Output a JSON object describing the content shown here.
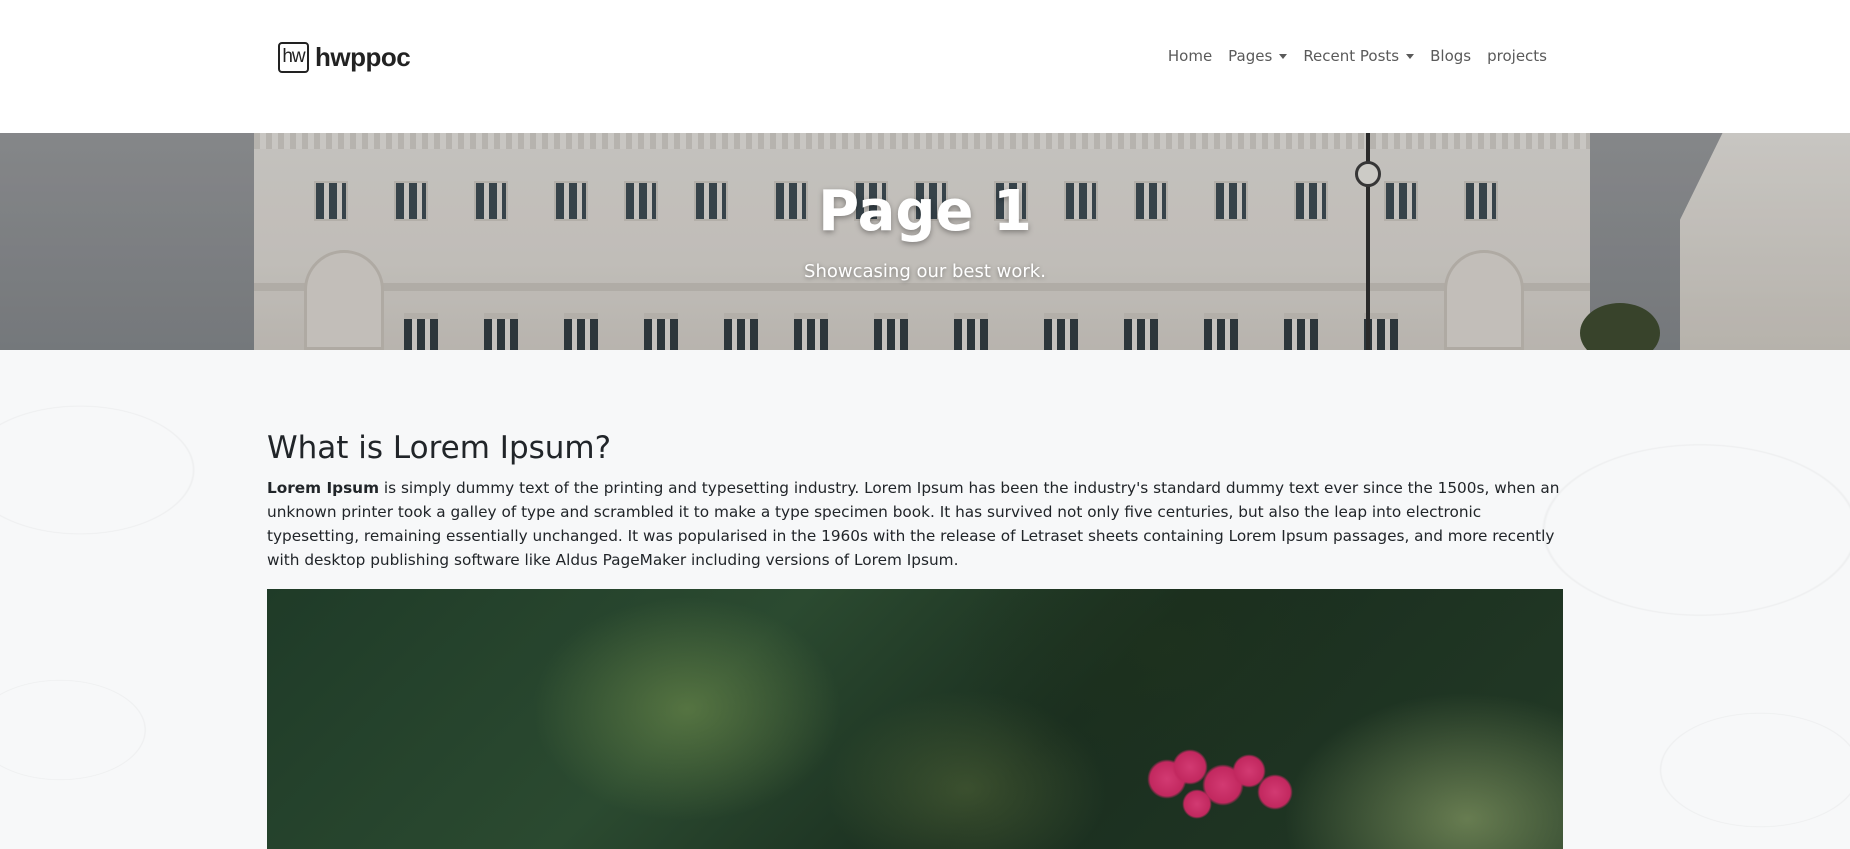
{
  "brand": {
    "logo_mark": "hw",
    "name": "hwppoc"
  },
  "nav": {
    "items": [
      {
        "label": "Home",
        "dropdown": false
      },
      {
        "label": "Pages",
        "dropdown": true
      },
      {
        "label": "Recent Posts",
        "dropdown": true
      },
      {
        "label": "Blogs",
        "dropdown": false
      },
      {
        "label": "projects",
        "dropdown": false
      }
    ]
  },
  "hero": {
    "title": "Page 1",
    "subtitle": "Showcasing our best work."
  },
  "article": {
    "heading": "What is Lorem Ipsum?",
    "bold_lead": "Lorem Ipsum",
    "body": " is simply dummy text of the printing and typesetting industry. Lorem Ipsum has been the industry's standard dummy text ever since the 1500s, when an unknown printer took a galley of type and scrambled it to make a type specimen book. It has survived not only five centuries, but also the leap into electronic typesetting, remaining essentially unchanged. It was popularised in the 1960s with the release of Letraset sheets containing Lorem Ipsum passages, and more recently with desktop publishing software like Aldus PageMaker including versions of Lorem Ipsum."
  },
  "colors": {
    "nav_text": "#5a5a5a",
    "body_text": "#212529",
    "page_background": "#f7f8f9",
    "hero_text": "#ffffff"
  },
  "icons": {
    "dropdown": "caret-down-icon"
  }
}
